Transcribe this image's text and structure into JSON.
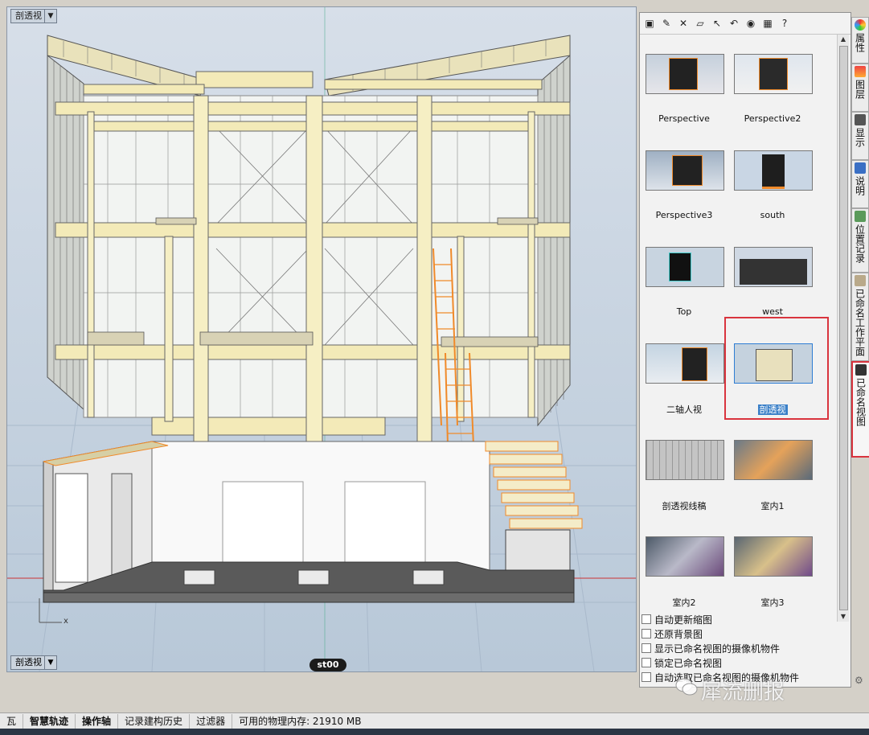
{
  "viewport": {
    "title": "剖透视",
    "bottom_tab": "剖透视",
    "badge": "st00",
    "axis_label": "x"
  },
  "panel": {
    "toolbar_icons": [
      "save-icon",
      "edit-icon",
      "delete-icon",
      "folder-open-icon",
      "restore-icon",
      "undo-icon",
      "eye-icon",
      "film-icon",
      "help-icon"
    ],
    "thumbnails": [
      {
        "label": "Perspective"
      },
      {
        "label": "Perspective2"
      },
      {
        "label": "Perspective3"
      },
      {
        "label": "south"
      },
      {
        "label": "Top"
      },
      {
        "label": "west"
      },
      {
        "label": "二轴人视"
      },
      {
        "label": "剖透视",
        "selected": true
      },
      {
        "label": "剖透视线稿"
      },
      {
        "label": "室内1"
      },
      {
        "label": "室内2"
      },
      {
        "label": "室内3"
      }
    ],
    "options": [
      {
        "label": "自动更新缩图",
        "checked": false
      },
      {
        "label": "还原背景图",
        "checked": false
      },
      {
        "label": "显示已命名视图的摄像机物件",
        "checked": false
      },
      {
        "label": "锁定已命名视图",
        "checked": false
      },
      {
        "label": "自动选取已命名视图的摄像机物件",
        "checked": false
      }
    ]
  },
  "right_tabs": [
    {
      "label": "属性",
      "icon": "properties-icon"
    },
    {
      "label": "图层",
      "icon": "layers-icon"
    },
    {
      "label": "显示",
      "icon": "display-icon"
    },
    {
      "label": "说明",
      "icon": "help-icon"
    },
    {
      "label": "位置记录",
      "icon": "location-icon"
    },
    {
      "label": "已命名工作平面",
      "icon": "cplane-icon"
    },
    {
      "label": "已命名视图",
      "icon": "camera-icon",
      "active": true
    }
  ],
  "status_bar": {
    "items": [
      {
        "label": "瓦"
      },
      {
        "label": "智慧轨迹",
        "bold": true
      },
      {
        "label": "操作轴",
        "bold": true
      },
      {
        "label": "记录建构历史"
      },
      {
        "label": "过滤器"
      },
      {
        "label": "可用的物理内存: 21910 MB"
      }
    ]
  },
  "watermark": "犀流删报",
  "colors": {
    "selection_frame": "#d9343e",
    "timber": "#f3eab8",
    "orange": "#f08a2a",
    "viewport_bg": "#c7d3e0"
  }
}
